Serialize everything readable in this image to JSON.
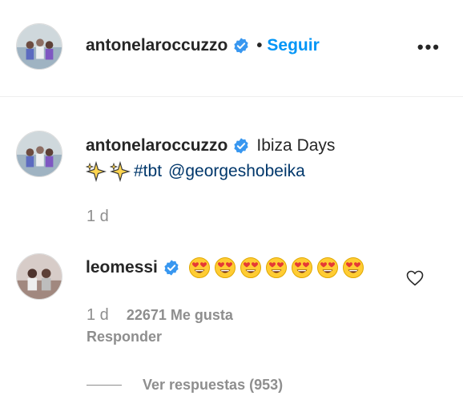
{
  "header": {
    "username": "antonelaroccuzzo",
    "separator": "•",
    "follow_label": "Seguir",
    "more_label": "•••"
  },
  "caption": {
    "username": "antonelaroccuzzo",
    "text": "Ibiza Days",
    "hashtag": "#tbt",
    "mention": "@georgeshobeika",
    "time": "1 d"
  },
  "comment": {
    "username": "leomessi",
    "emoji_count": 7,
    "time": "1 d",
    "likes": "22671 Me gusta",
    "reply_label": "Responder",
    "view_replies_label": "Ver respuestas (953)"
  },
  "colors": {
    "accent": "#0095f6",
    "link": "#00376b",
    "muted": "#8e8e8e",
    "verified": "#3897f0"
  },
  "icons": [
    "verified-badge-icon",
    "more-options-icon",
    "sparkles-icon",
    "heart-eyes-emoji-icon",
    "heart-icon"
  ]
}
